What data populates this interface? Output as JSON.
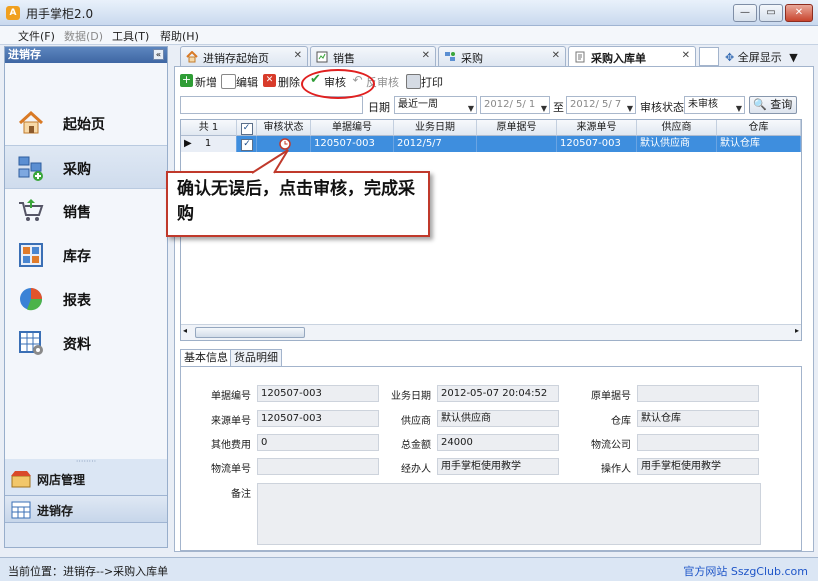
{
  "window": {
    "title": "用手掌柜2.0",
    "icon_letter": "A",
    "controls": [
      "—",
      "▭",
      "✕"
    ]
  },
  "menu": [
    {
      "label": "文件(F)",
      "enabled": true
    },
    {
      "label": "数据(D)",
      "enabled": false
    },
    {
      "label": "工具(T)",
      "enabled": true
    },
    {
      "label": "帮助(H)",
      "enabled": true
    }
  ],
  "sidebar": {
    "header": "进销存",
    "collapse_glyph": "«",
    "items": [
      {
        "label": "起始页",
        "icon": "home-icon"
      },
      {
        "label": "采购",
        "icon": "purchase-icon",
        "selected": true
      },
      {
        "label": "销售",
        "icon": "cart-icon"
      },
      {
        "label": "库存",
        "icon": "inventory-icon"
      },
      {
        "label": "报表",
        "icon": "pie-chart-icon"
      },
      {
        "label": "资料",
        "icon": "data-icon"
      }
    ],
    "bottom": [
      {
        "label": "网店管理",
        "icon": "shop-icon"
      },
      {
        "label": "进销存",
        "icon": "calculator-icon",
        "selected": true
      }
    ]
  },
  "tabs": [
    {
      "label": "进销存起始页",
      "icon": "home-icon"
    },
    {
      "label": "销售",
      "icon": "sales-icon"
    },
    {
      "label": "采购",
      "icon": "purchase-icon"
    },
    {
      "label": "采购入库单",
      "icon": "document-icon",
      "active": true
    }
  ],
  "fullscreen_label": "全屏显示",
  "toolbar": {
    "new": "新增",
    "edit": "编辑",
    "delete": "删除",
    "approve": "审核",
    "unapprove": "反审核",
    "print": "打印"
  },
  "filter": {
    "date_label": "日期",
    "date_range": "最近一周",
    "date_from": "2012/ 5/ 1",
    "to_label": "至",
    "date_to": "2012/ 5/ 7",
    "status_label": "审核状态",
    "status_value": "未审核",
    "search_button": "查询"
  },
  "grid": {
    "columns": [
      "共 1",
      "✓",
      "审核状态",
      "单据编号",
      "业务日期",
      "原单据号",
      "来源单号",
      "供应商",
      "仓库"
    ],
    "rows": [
      {
        "index": "1",
        "checked": true,
        "status_icon": "clock-icon",
        "doc_no": "120507-003",
        "date": "2012/5/7",
        "orig_no": "",
        "source_no": "120507-003",
        "supplier": "默认供应商",
        "warehouse": "默认仓库"
      }
    ]
  },
  "callout": "确认无误后，点击审核，完成采购",
  "detail_tabs": [
    "基本信息",
    "货品明细"
  ],
  "detail": {
    "doc_no_label": "单据编号",
    "doc_no": "120507-003",
    "biz_date_label": "业务日期",
    "biz_date": "2012-05-07 20:04:52",
    "orig_no_label": "原单据号",
    "orig_no": "",
    "source_no_label": "来源单号",
    "source_no": "120507-003",
    "supplier_label": "供应商",
    "supplier": "默认供应商",
    "warehouse_label": "仓库",
    "warehouse": "默认仓库",
    "other_fee_label": "其他费用",
    "other_fee": "0",
    "total_label": "总金额",
    "total": "24000",
    "logistics_co_label": "物流公司",
    "logistics_co": "",
    "logistics_no_label": "物流单号",
    "logistics_no": "",
    "handler_label": "经办人",
    "handler": "用手掌柜使用教学",
    "operator_label": "操作人",
    "operator": "用手掌柜使用教学",
    "remark_label": "备注",
    "remark": ""
  },
  "status": {
    "location": "当前位置：进销存-->采购入库单",
    "website": "官方网站 SszgClub.com"
  }
}
